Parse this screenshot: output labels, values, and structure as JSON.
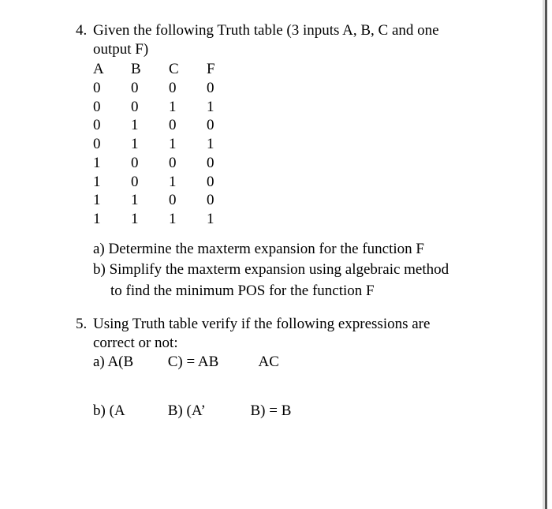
{
  "q4": {
    "number": "4.",
    "text_line1": "Given the following Truth table (3 inputs A, B, C and one",
    "text_line2": "output F)",
    "table": {
      "headers": [
        "A",
        "B",
        "C",
        "F"
      ],
      "rows": [
        [
          "0",
          "0",
          "0",
          "0"
        ],
        [
          "0",
          "0",
          "1",
          "1"
        ],
        [
          "0",
          "1",
          "0",
          "0"
        ],
        [
          "0",
          "1",
          "1",
          "1"
        ],
        [
          "1",
          "0",
          "0",
          "0"
        ],
        [
          "1",
          "0",
          "1",
          "0"
        ],
        [
          "1",
          "1",
          "0",
          "0"
        ],
        [
          "1",
          "1",
          "1",
          "1"
        ]
      ]
    },
    "a": "a) Determine the maxterm expansion for the function F",
    "b_line1": "b) Simplify the maxterm expansion using algebraic method",
    "b_line2": "to find the minimum POS for the function F"
  },
  "q5": {
    "number": "5.",
    "text_line1": "Using Truth table verify if the following expressions are",
    "text_line2": "correct or not:",
    "a": {
      "p1": "a) A(B",
      "p2": "C) = AB",
      "p3": "AC"
    },
    "b": {
      "p1": "b) (A",
      "p2": "B) (A’",
      "p3": "B) = B"
    }
  }
}
